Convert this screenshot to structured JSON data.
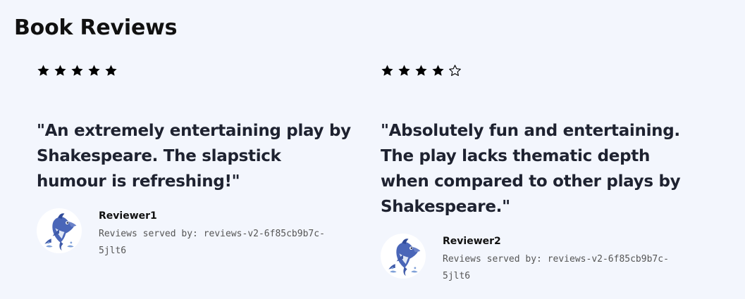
{
  "page": {
    "title": "Book Reviews"
  },
  "reviews": [
    {
      "stars": {
        "filled": 5,
        "total": 5
      },
      "quote": "\"An extremely entertaining play by Shakespeare. The slapstick humour is refreshing!\"",
      "reviewer": "Reviewer1",
      "served_by": "Reviews served by: reviews-v2-6f85cb9b7c-5jlt6",
      "avatar_icon": "dolphin-icon"
    },
    {
      "stars": {
        "filled": 4,
        "total": 5
      },
      "quote": "\"Absolutely fun and entertaining. The play lacks thematic depth when compared to other plays by Shakespeare.\"",
      "reviewer": "Reviewer2",
      "served_by": "Reviews served by: reviews-v2-6f85cb9b7c-5jlt6",
      "avatar_icon": "dolphin-icon"
    }
  ],
  "colors": {
    "background": "#f3f6fd",
    "star_fill": "#000000"
  }
}
